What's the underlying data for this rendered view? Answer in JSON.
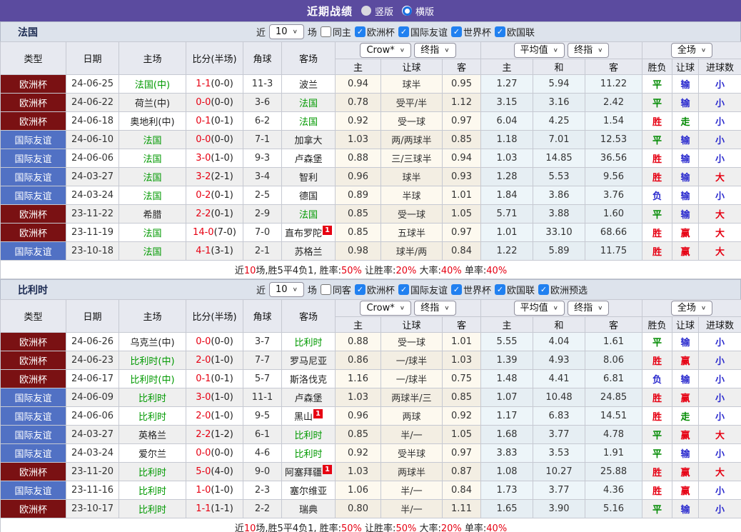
{
  "topbar": {
    "title": "近期战绩",
    "radios": [
      {
        "label": "竖版",
        "checked": false
      },
      {
        "label": "横版",
        "checked": true
      }
    ]
  },
  "colors": {
    "topbar_purple": "#5b4b9f",
    "cup_red": "#7a1113",
    "friendly_blue": "#5171c4",
    "win_red": "#e60012",
    "draw_green": "#008a00",
    "lose_blue": "#2a2ace",
    "team_green": "#009900",
    "checkbox_blue": "#2080f0"
  },
  "table_header": {
    "cols": [
      "类型",
      "日期",
      "主场",
      "比分(半场)",
      "角球",
      "客场"
    ],
    "sub": [
      "主",
      "让球",
      "客",
      "主",
      "和",
      "客",
      "胜负",
      "让球",
      "进球数"
    ],
    "selects": {
      "company": "Crow*",
      "company_stage": "终指",
      "average": "平均值",
      "average_stage": "终指",
      "scope": "全场"
    },
    "chevron_icon": "∨"
  },
  "sections": [
    {
      "name": "法国",
      "filter": {
        "near_label": "近",
        "count_value": "10",
        "games_label": "场",
        "same_label": "同主",
        "same_checked": false,
        "leagues": [
          {
            "label": "欧洲杯",
            "checked": true
          },
          {
            "label": "国际友谊",
            "checked": true
          },
          {
            "label": "世界杯",
            "checked": true
          },
          {
            "label": "欧国联",
            "checked": true
          }
        ]
      },
      "rows": [
        {
          "type": "欧洲杯",
          "cls": "cup",
          "date": "24-06-25",
          "home": "法国(中)",
          "homeGreen": true,
          "score": "1-1",
          "half": "(0-0)",
          "corner": "11-3",
          "away": "波兰",
          "awayGreen": false,
          "awayBadge": "",
          "odds": [
            "0.94",
            "球半",
            "0.95"
          ],
          "avg": [
            "1.27",
            "5.94",
            "11.22"
          ],
          "res": [
            "平",
            "输",
            "小"
          ]
        },
        {
          "type": "欧洲杯",
          "cls": "cup",
          "date": "24-06-22",
          "home": "荷兰(中)",
          "homeGreen": false,
          "score": "0-0",
          "half": "(0-0)",
          "corner": "3-6",
          "away": "法国",
          "awayGreen": true,
          "awayBadge": "",
          "odds": [
            "0.78",
            "受平/半",
            "1.12"
          ],
          "avg": [
            "3.15",
            "3.16",
            "2.42"
          ],
          "res": [
            "平",
            "输",
            "小"
          ]
        },
        {
          "type": "欧洲杯",
          "cls": "cup",
          "date": "24-06-18",
          "home": "奥地利(中)",
          "homeGreen": false,
          "score": "0-1",
          "half": "(0-1)",
          "corner": "6-2",
          "away": "法国",
          "awayGreen": true,
          "awayBadge": "",
          "odds": [
            "0.92",
            "受一球",
            "0.97"
          ],
          "avg": [
            "6.04",
            "4.25",
            "1.54"
          ],
          "res": [
            "胜",
            "走",
            "小"
          ]
        },
        {
          "type": "国际友谊",
          "cls": "fri",
          "date": "24-06-10",
          "home": "法国",
          "homeGreen": true,
          "score": "0-0",
          "half": "(0-0)",
          "corner": "7-1",
          "away": "加拿大",
          "awayGreen": false,
          "awayBadge": "",
          "odds": [
            "1.03",
            "两/两球半",
            "0.85"
          ],
          "avg": [
            "1.18",
            "7.01",
            "12.53"
          ],
          "res": [
            "平",
            "输",
            "小"
          ]
        },
        {
          "type": "国际友谊",
          "cls": "fri",
          "date": "24-06-06",
          "home": "法国",
          "homeGreen": true,
          "score": "3-0",
          "half": "(1-0)",
          "corner": "9-3",
          "away": "卢森堡",
          "awayGreen": false,
          "awayBadge": "",
          "odds": [
            "0.88",
            "三/三球半",
            "0.94"
          ],
          "avg": [
            "1.03",
            "14.85",
            "36.56"
          ],
          "res": [
            "胜",
            "输",
            "小"
          ]
        },
        {
          "type": "国际友谊",
          "cls": "fri",
          "date": "24-03-27",
          "home": "法国",
          "homeGreen": true,
          "score": "3-2",
          "half": "(2-1)",
          "corner": "3-4",
          "away": "智利",
          "awayGreen": false,
          "awayBadge": "",
          "odds": [
            "0.96",
            "球半",
            "0.93"
          ],
          "avg": [
            "1.28",
            "5.53",
            "9.56"
          ],
          "res": [
            "胜",
            "输",
            "大"
          ]
        },
        {
          "type": "国际友谊",
          "cls": "fri",
          "date": "24-03-24",
          "home": "法国",
          "homeGreen": true,
          "score": "0-2",
          "half": "(0-1)",
          "corner": "2-5",
          "away": "德国",
          "awayGreen": false,
          "awayBadge": "",
          "odds": [
            "0.89",
            "半球",
            "1.01"
          ],
          "avg": [
            "1.84",
            "3.86",
            "3.76"
          ],
          "res": [
            "负",
            "输",
            "小"
          ]
        },
        {
          "type": "欧洲杯",
          "cls": "cup",
          "date": "23-11-22",
          "home": "希腊",
          "homeGreen": false,
          "score": "2-2",
          "half": "(0-1)",
          "corner": "2-9",
          "away": "法国",
          "awayGreen": true,
          "awayBadge": "",
          "odds": [
            "0.85",
            "受一球",
            "1.05"
          ],
          "avg": [
            "5.71",
            "3.88",
            "1.60"
          ],
          "res": [
            "平",
            "输",
            "大"
          ]
        },
        {
          "type": "欧洲杯",
          "cls": "cup",
          "date": "23-11-19",
          "home": "法国",
          "homeGreen": true,
          "score": "14-0",
          "half": "(7-0)",
          "corner": "7-0",
          "away": "直布罗陀",
          "awayGreen": false,
          "awayBadge": "1",
          "odds": [
            "0.85",
            "五球半",
            "0.97"
          ],
          "avg": [
            "1.01",
            "33.10",
            "68.66"
          ],
          "res": [
            "胜",
            "赢",
            "大"
          ]
        },
        {
          "type": "国际友谊",
          "cls": "fri",
          "date": "23-10-18",
          "home": "法国",
          "homeGreen": true,
          "score": "4-1",
          "half": "(3-1)",
          "corner": "2-1",
          "away": "苏格兰",
          "awayGreen": false,
          "awayBadge": "",
          "odds": [
            "0.98",
            "球半/两",
            "0.84"
          ],
          "avg": [
            "1.22",
            "5.89",
            "11.75"
          ],
          "res": [
            "胜",
            "赢",
            "大"
          ]
        }
      ],
      "summary": [
        [
          "近",
          "k"
        ],
        [
          "10",
          "r"
        ],
        [
          "场,胜5平4负1, 胜率:",
          "k"
        ],
        [
          "50%",
          "r"
        ],
        [
          " 让胜率:",
          "k"
        ],
        [
          "20%",
          "r"
        ],
        [
          " 大率:",
          "k"
        ],
        [
          "40%",
          "r"
        ],
        [
          " 单率:",
          "k"
        ],
        [
          "40%",
          "r"
        ]
      ]
    },
    {
      "name": "比利时",
      "filter": {
        "near_label": "近",
        "count_value": "10",
        "games_label": "场",
        "same_label": "同客",
        "same_checked": false,
        "leagues": [
          {
            "label": "欧洲杯",
            "checked": true
          },
          {
            "label": "国际友谊",
            "checked": true
          },
          {
            "label": "世界杯",
            "checked": true
          },
          {
            "label": "欧国联",
            "checked": true
          },
          {
            "label": "欧洲预选",
            "checked": true
          }
        ]
      },
      "rows": [
        {
          "type": "欧洲杯",
          "cls": "cup",
          "date": "24-06-26",
          "home": "乌克兰(中)",
          "homeGreen": false,
          "score": "0-0",
          "half": "(0-0)",
          "corner": "3-7",
          "away": "比利时",
          "awayGreen": true,
          "awayBadge": "",
          "odds": [
            "0.88",
            "受一球",
            "1.01"
          ],
          "avg": [
            "5.55",
            "4.04",
            "1.61"
          ],
          "res": [
            "平",
            "输",
            "小"
          ]
        },
        {
          "type": "欧洲杯",
          "cls": "cup",
          "date": "24-06-23",
          "home": "比利时(中)",
          "homeGreen": true,
          "score": "2-0",
          "half": "(1-0)",
          "corner": "7-7",
          "away": "罗马尼亚",
          "awayGreen": false,
          "awayBadge": "",
          "odds": [
            "0.86",
            "一/球半",
            "1.03"
          ],
          "avg": [
            "1.39",
            "4.93",
            "8.06"
          ],
          "res": [
            "胜",
            "赢",
            "小"
          ]
        },
        {
          "type": "欧洲杯",
          "cls": "cup",
          "date": "24-06-17",
          "home": "比利时(中)",
          "homeGreen": true,
          "score": "0-1",
          "half": "(0-1)",
          "corner": "5-7",
          "away": "斯洛伐克",
          "awayGreen": false,
          "awayBadge": "",
          "odds": [
            "1.16",
            "一/球半",
            "0.75"
          ],
          "avg": [
            "1.48",
            "4.41",
            "6.81"
          ],
          "res": [
            "负",
            "输",
            "小"
          ]
        },
        {
          "type": "国际友谊",
          "cls": "fri",
          "date": "24-06-09",
          "home": "比利时",
          "homeGreen": true,
          "score": "3-0",
          "half": "(1-0)",
          "corner": "11-1",
          "away": "卢森堡",
          "awayGreen": false,
          "awayBadge": "",
          "odds": [
            "1.03",
            "两球半/三",
            "0.85"
          ],
          "avg": [
            "1.07",
            "10.48",
            "24.85"
          ],
          "res": [
            "胜",
            "赢",
            "小"
          ]
        },
        {
          "type": "国际友谊",
          "cls": "fri",
          "date": "24-06-06",
          "home": "比利时",
          "homeGreen": true,
          "score": "2-0",
          "half": "(1-0)",
          "corner": "9-5",
          "away": "黑山",
          "awayGreen": false,
          "awayBadge": "1",
          "odds": [
            "0.96",
            "两球",
            "0.92"
          ],
          "avg": [
            "1.17",
            "6.83",
            "14.51"
          ],
          "res": [
            "胜",
            "走",
            "小"
          ]
        },
        {
          "type": "国际友谊",
          "cls": "fri",
          "date": "24-03-27",
          "home": "英格兰",
          "homeGreen": false,
          "score": "2-2",
          "half": "(1-2)",
          "corner": "6-1",
          "away": "比利时",
          "awayGreen": true,
          "awayBadge": "",
          "odds": [
            "0.85",
            "半/一",
            "1.05"
          ],
          "avg": [
            "1.68",
            "3.77",
            "4.78"
          ],
          "res": [
            "平",
            "赢",
            "大"
          ]
        },
        {
          "type": "国际友谊",
          "cls": "fri",
          "date": "24-03-24",
          "home": "爱尔兰",
          "homeGreen": false,
          "score": "0-0",
          "half": "(0-0)",
          "corner": "4-6",
          "away": "比利时",
          "awayGreen": true,
          "awayBadge": "",
          "odds": [
            "0.92",
            "受半球",
            "0.97"
          ],
          "avg": [
            "3.83",
            "3.53",
            "1.91"
          ],
          "res": [
            "平",
            "输",
            "小"
          ]
        },
        {
          "type": "欧洲杯",
          "cls": "cup",
          "date": "23-11-20",
          "home": "比利时",
          "homeGreen": true,
          "score": "5-0",
          "half": "(4-0)",
          "corner": "9-0",
          "away": "阿塞拜疆",
          "awayGreen": false,
          "awayBadge": "1",
          "odds": [
            "1.03",
            "两球半",
            "0.87"
          ],
          "avg": [
            "1.08",
            "10.27",
            "25.88"
          ],
          "res": [
            "胜",
            "赢",
            "大"
          ]
        },
        {
          "type": "国际友谊",
          "cls": "fri",
          "date": "23-11-16",
          "home": "比利时",
          "homeGreen": true,
          "score": "1-0",
          "half": "(1-0)",
          "corner": "2-3",
          "away": "塞尔维亚",
          "awayGreen": false,
          "awayBadge": "",
          "odds": [
            "1.06",
            "半/一",
            "0.84"
          ],
          "avg": [
            "1.73",
            "3.77",
            "4.36"
          ],
          "res": [
            "胜",
            "赢",
            "小"
          ]
        },
        {
          "type": "欧洲杯",
          "cls": "cup",
          "date": "23-10-17",
          "home": "比利时",
          "homeGreen": true,
          "score": "1-1",
          "half": "(1-1)",
          "corner": "2-2",
          "away": "瑞典",
          "awayGreen": false,
          "awayBadge": "",
          "odds": [
            "0.80",
            "半/一",
            "1.11"
          ],
          "avg": [
            "1.65",
            "3.90",
            "5.16"
          ],
          "res": [
            "平",
            "输",
            "小"
          ]
        }
      ],
      "summary": [
        [
          "近",
          "k"
        ],
        [
          "10",
          "r"
        ],
        [
          "场,胜5平4负1, 胜率:",
          "k"
        ],
        [
          "50%",
          "r"
        ],
        [
          " 让胜率:",
          "k"
        ],
        [
          "50%",
          "r"
        ],
        [
          " 大率:",
          "k"
        ],
        [
          "20%",
          "r"
        ],
        [
          " 单率:",
          "k"
        ],
        [
          "40%",
          "r"
        ]
      ]
    }
  ]
}
